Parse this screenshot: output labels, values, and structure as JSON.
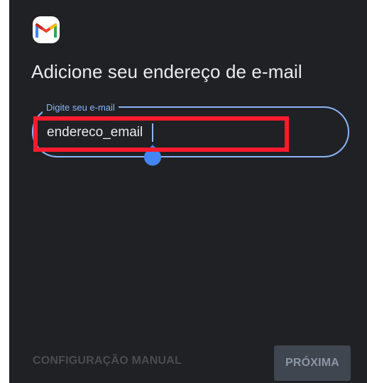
{
  "header": {
    "logo_icon": "gmail-icon",
    "title": "Adicione seu endereço de e-mail"
  },
  "email_field": {
    "label": "Digite seu e-mail",
    "value": "endereco_email",
    "focused": true
  },
  "footer": {
    "manual_setup_label": "CONFIGURAÇÃO MANUAL",
    "next_label": "PRÓXIMA",
    "next_enabled": false
  },
  "colors": {
    "background": "#202124",
    "accent": "#8ab4f8",
    "highlight": "#ff1a2e",
    "text": "#e8eaed"
  }
}
